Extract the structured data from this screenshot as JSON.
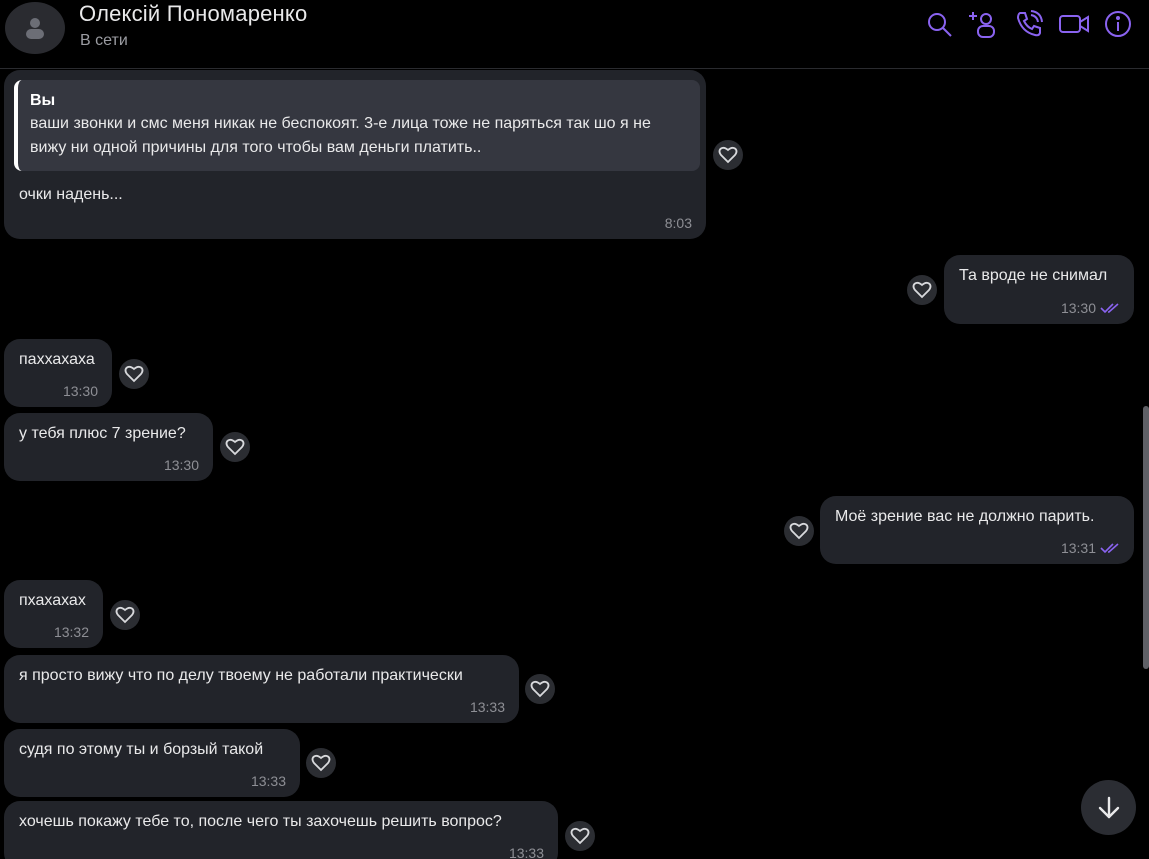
{
  "header": {
    "name": "Олексій Пономаренко",
    "status": "В сети",
    "icons": [
      "search-icon",
      "add-member-icon",
      "call-icon",
      "video-call-icon",
      "info-icon"
    ]
  },
  "colors": {
    "accent": "#8a63f0",
    "bubble": "#22242a",
    "quote_bg": "#353740",
    "background": "#000000",
    "time": "#8e8f95"
  },
  "messages": [
    {
      "direction": "in",
      "quote": {
        "author": "Вы",
        "text": "ваши звонки и смс меня никак не беспокоят. 3-е лица тоже не паряться так шо я не вижу ни одной причины для того чтобы вам деньги платить.."
      },
      "text": "очки надень...",
      "time": "8:03"
    },
    {
      "direction": "out",
      "text": "Та вроде не снимал",
      "time": "13:30",
      "read": true
    },
    {
      "direction": "in",
      "text": "паххахаха",
      "time": "13:30"
    },
    {
      "direction": "in",
      "text": "у тебя плюс 7 зрение?",
      "time": "13:30"
    },
    {
      "direction": "out",
      "text": "Моё зрение вас не должно парить.",
      "time": "13:31",
      "read": true
    },
    {
      "direction": "in",
      "text": "пхахахах",
      "time": "13:32"
    },
    {
      "direction": "in",
      "text": "я просто вижу что по делу твоему не работали практически",
      "time": "13:33"
    },
    {
      "direction": "in",
      "text": "судя по этому ты и борзый такой",
      "time": "13:33"
    },
    {
      "direction": "in",
      "text": "хочешь покажу тебе то, после чего ты захочешь решить вопрос?",
      "time": "13:33"
    }
  ]
}
